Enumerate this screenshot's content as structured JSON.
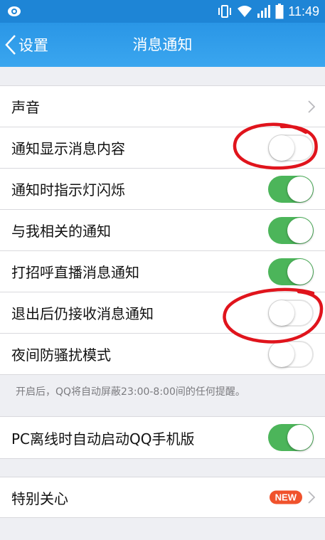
{
  "status_bar": {
    "time": "11:49",
    "icons": [
      "eye-icon",
      "vibrate-icon",
      "wifi-icon",
      "signal-icon",
      "battery-icon"
    ]
  },
  "nav": {
    "back_label": "设置",
    "title": "消息通知"
  },
  "settings": {
    "sound": {
      "label": "声音"
    },
    "show_content": {
      "label": "通知显示消息内容",
      "on": false
    },
    "indicator_light": {
      "label": "通知时指示灯闪烁",
      "on": true
    },
    "related_notify": {
      "label": "与我相关的通知",
      "on": true
    },
    "greeting_live": {
      "label": "打招呼直播消息通知",
      "on": true
    },
    "receive_after_exit": {
      "label": "退出后仍接收消息通知",
      "on": false
    },
    "night_mode": {
      "label": "夜间防骚扰模式",
      "on": false
    },
    "night_hint": "开启后，QQ将自动屏蔽23:00-8:00间的任何提醒。",
    "pc_offline": {
      "label": "PC离线时自动启动QQ手机版",
      "on": true
    },
    "special_care": {
      "label": "特别关心",
      "badge": "NEW"
    }
  },
  "colors": {
    "header": "#2a96e6",
    "toggle_on": "#4cb55a",
    "badge": "#f0522c",
    "annotation": "#e0141c"
  }
}
